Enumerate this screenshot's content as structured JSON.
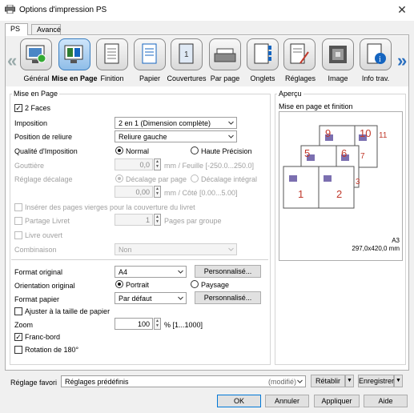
{
  "window": {
    "title": "Options d'impression PS",
    "close_glyph": "✕"
  },
  "tabs": [
    {
      "label": "PS"
    },
    {
      "label": "Avancé"
    }
  ],
  "toolbar": {
    "items": [
      {
        "label": "Général"
      },
      {
        "label": "Mise en Page"
      },
      {
        "label": "Finition"
      },
      {
        "label": "Papier"
      },
      {
        "label": "Couvertures"
      },
      {
        "label": "Par page"
      },
      {
        "label": "Onglets"
      },
      {
        "label": "Réglages"
      },
      {
        "label": "Image"
      },
      {
        "label": "Info trav."
      }
    ],
    "selected": "Mise en Page",
    "left_arrow": "«",
    "right_arrow": "»"
  },
  "layout_group": {
    "title": "Mise en Page",
    "two_sided": {
      "label": "2 Faces",
      "checked": true
    },
    "imposition": {
      "label": "Imposition",
      "value": "2 en 1 (Dimension complète)"
    },
    "binding": {
      "label": "Position de reliure",
      "value": "Reliure gauche"
    },
    "quality": {
      "label": "Qualité d'Imposition",
      "opt1": "Normal",
      "opt2": "Haute Précision"
    },
    "gutter": {
      "label": "Gouttière",
      "value": "0,0",
      "unit": "mm / Feuille [-250.0...250.0]"
    },
    "offset": {
      "label": "Réglage décalage",
      "opt1": "Décalage par page",
      "opt2": "Décalage intégral"
    },
    "offset_value": {
      "value": "0,00",
      "unit": "mm / Côté [0.00...5.00]"
    },
    "insert_blank": {
      "label": "Insérer des pages vierges pour la couverture du livret"
    },
    "split_booklet": {
      "label": "Partage Livret",
      "value": "1",
      "unit": "Pages par groupe"
    },
    "open_book": {
      "label": "Livre ouvert"
    },
    "combination": {
      "label": "Combinaison",
      "value": "Non"
    }
  },
  "paper": {
    "original_format": {
      "label": "Format original",
      "value": "A4",
      "button": "Personnalisé..."
    },
    "orientation": {
      "label": "Orientation original",
      "opt1": "Portrait",
      "opt2": "Paysage"
    },
    "paper_format": {
      "label": "Format papier",
      "value": "Par défaut",
      "button": "Personnalisé..."
    },
    "fit": {
      "label": "Ajuster à la taille de papier"
    },
    "zoom": {
      "label": "Zoom",
      "value": "100",
      "unit": "% [1...1000]"
    },
    "border": {
      "label": "Franc-bord",
      "checked": true
    },
    "rotate": {
      "label": "Rotation de 180°"
    }
  },
  "preview": {
    "title": "Aperçu",
    "subtitle": "Mise en page et finition",
    "pages": [
      "9",
      "10",
      "11",
      "5",
      "6",
      "7",
      "1",
      "2",
      "3"
    ],
    "size_label": "A3",
    "size_dims": "297,0x420,0 mm"
  },
  "favorites": {
    "label": "Réglage favori",
    "value": "Réglages prédéfinis",
    "modified": "(modifié)",
    "restore": "Rétablir",
    "save": "Enregistrer"
  },
  "buttons": {
    "ok": "OK",
    "cancel": "Annuler",
    "apply": "Appliquer",
    "help": "Aide"
  }
}
